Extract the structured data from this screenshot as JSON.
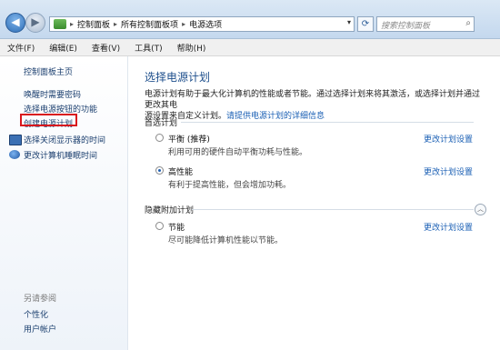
{
  "titlebar": {
    "breadcrumbs": [
      "控制面板",
      "所有控制面板项",
      "电源选项"
    ],
    "search_placeholder": "搜索控制面板"
  },
  "menu": [
    "文件(F)",
    "编辑(E)",
    "查看(V)",
    "工具(T)",
    "帮助(H)"
  ],
  "sidebar": {
    "home": "控制面板主页",
    "links": [
      "唤醒时需要密码",
      "选择电源按钮的功能",
      "创建电源计划"
    ],
    "icon_links": [
      "选择关闭显示器的时间",
      "更改计算机睡眠时间"
    ],
    "see_also_title": "另请参阅",
    "see_also": [
      "个性化",
      "用户帐户"
    ]
  },
  "main": {
    "title": "选择电源计划",
    "desc_line1": "电源计划有助于最大化计算机的性能或者节能。通过选择计划来将其激活，或选择计划并通过更改其电",
    "desc_line2_prefix": "源设置来自定义计划。",
    "desc_link": "请提供电源计划的详细信息",
    "preferred_heading": "首选计划",
    "hidden_heading": "隐藏附加计划",
    "change_label": "更改计划设置",
    "plans": [
      {
        "name": "平衡 (推荐)",
        "desc": "利用可用的硬件自动平衡功耗与性能。",
        "selected": false
      },
      {
        "name": "高性能",
        "desc": "有利于提高性能，但会增加功耗。",
        "selected": true
      },
      {
        "name": "节能",
        "desc": "尽可能降低计算机性能以节能。",
        "selected": false
      }
    ]
  }
}
